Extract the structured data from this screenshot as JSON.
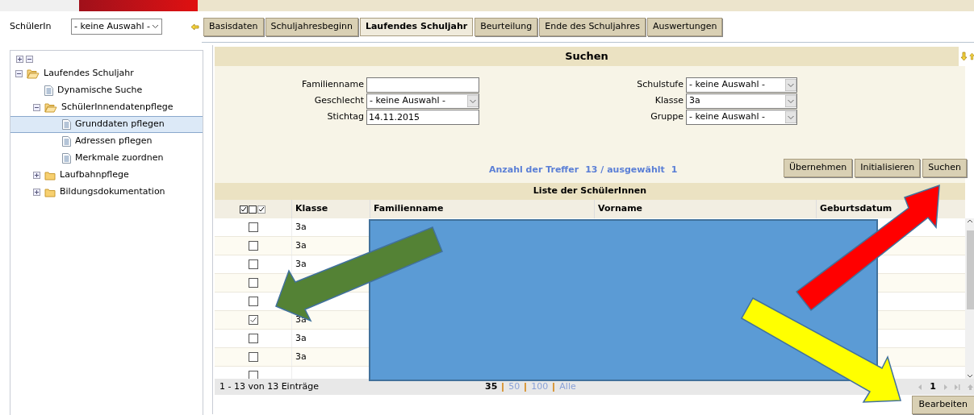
{
  "student_select": {
    "label": "SchülerIn",
    "value": "- keine Auswahl -"
  },
  "tabs": [
    {
      "label": "Basisdaten",
      "selected": false
    },
    {
      "label": "Schuljahresbeginn",
      "selected": false
    },
    {
      "label": "Laufendes Schuljahr",
      "selected": true
    },
    {
      "label": "Beurteilung",
      "selected": false
    },
    {
      "label": "Ende des Schuljahres",
      "selected": false
    },
    {
      "label": "Auswertungen",
      "selected": false
    }
  ],
  "tree": [
    {
      "label": "Laufendes Schuljahr",
      "kind": "folder",
      "expanded": true,
      "selected": false,
      "children": [
        {
          "label": "Dynamische Suche",
          "kind": "page",
          "selected": false
        },
        {
          "label": "SchülerInnendatenpflege",
          "kind": "folder",
          "expanded": true,
          "selected": false,
          "children": [
            {
              "label": "Grunddaten pflegen",
              "kind": "page",
              "selected": true
            },
            {
              "label": "Adressen pflegen",
              "kind": "page",
              "selected": false
            },
            {
              "label": "Merkmale zuordnen",
              "kind": "page",
              "selected": false
            }
          ]
        },
        {
          "label": "Laufbahnpflege",
          "kind": "folder",
          "expanded": false,
          "selected": false
        },
        {
          "label": "Bildungsdokumentation",
          "kind": "folder",
          "expanded": false,
          "selected": false
        }
      ]
    }
  ],
  "search": {
    "title": "Suchen",
    "left_fields": [
      {
        "label": "Familienname",
        "kind": "text"
      },
      {
        "label": "Geschlecht",
        "kind": "select",
        "value": "- keine Auswahl -"
      },
      {
        "label": "Stichtag",
        "kind": "text",
        "value": "14.11.2015"
      }
    ],
    "right_fields": [
      {
        "label": "Schulstufe",
        "kind": "select",
        "value": "- keine Auswahl -"
      },
      {
        "label": "Klasse",
        "kind": "select",
        "value": "3a"
      },
      {
        "label": "Gruppe",
        "kind": "select",
        "value": "- keine Auswahl -"
      }
    ],
    "hits_label": "Anzahl der Treffer",
    "hits_count": "13 / ausgewählt",
    "hits_selected": "1",
    "buttons": [
      "Übernehmen",
      "Initialisieren",
      "Suchen"
    ]
  },
  "list": {
    "title": "Liste der SchülerInnen",
    "columns": [
      "Klasse",
      "Familienname",
      "Vorname",
      "Geburtsdatum"
    ],
    "rows": [
      {
        "checked": false,
        "klasse": "3a"
      },
      {
        "checked": false,
        "klasse": "3a"
      },
      {
        "checked": false,
        "klasse": "3a"
      },
      {
        "checked": false
      },
      {
        "checked": false
      },
      {
        "checked": true,
        "klasse": "3a"
      },
      {
        "checked": false,
        "klasse": "3a"
      },
      {
        "checked": false,
        "klasse": "3a"
      },
      {
        "checked": false
      }
    ],
    "range": "1 - 13 von 13 Einträge",
    "page_sizes": [
      {
        "label": "35",
        "selected": true
      },
      {
        "label": "50",
        "selected": false
      },
      {
        "label": "100",
        "selected": false
      },
      {
        "label": "Alle",
        "selected": false
      }
    ],
    "page": "1"
  },
  "edit_button": "Bearbeiten"
}
